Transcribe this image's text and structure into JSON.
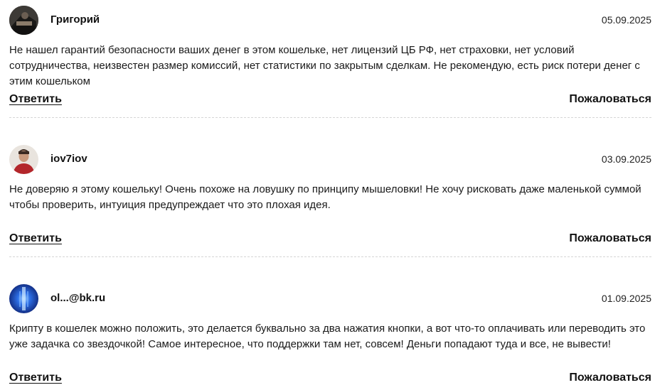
{
  "comments": [
    {
      "author": "Григорий",
      "date": "05.09.2025",
      "avatar_icon": "avatar-photo-icon",
      "text": "Не нашел гарантий безопасности ваших денег в этом кошельке, нет лицензий ЦБ РФ, нет страховки, нет условий сотрудничества, неизвестен размер комиссий, нет статистики по закрытым сделкам. Не рекомендую, есть риск потери денег с этим кошельком",
      "reply_label": "Ответить",
      "complain_label": "Пожаловаться"
    },
    {
      "author": "iov7iov",
      "date": "03.09.2025",
      "avatar_icon": "avatar-photo-icon",
      "text": "Не доверяю я этому кошельку! Очень похоже на ловушку по принципу мышеловки! Не хочу рисковать даже маленькой суммой чтобы проверить, интуиция предупреждает что это плохая идея.",
      "reply_label": "Ответить",
      "complain_label": "Пожаловаться"
    },
    {
      "author": "ol...@bk.ru",
      "date": "01.09.2025",
      "avatar_icon": "avatar-abstract-blue-icon",
      "text": "Крипту в кошелек можно положить, это делается буквально за два нажатия кнопки, а вот что-то оплачивать или переводить это уже задачка со звездочкой! Самое интересное, что поддержки там нет, совсем! Деньги попадают туда и все, не вывести!",
      "reply_label": "Ответить",
      "complain_label": "Пожаловаться"
    }
  ],
  "colors": {
    "text": "#1a1a1a",
    "divider": "#d6d6d6",
    "avatar_blue": "#1f4fd1"
  }
}
